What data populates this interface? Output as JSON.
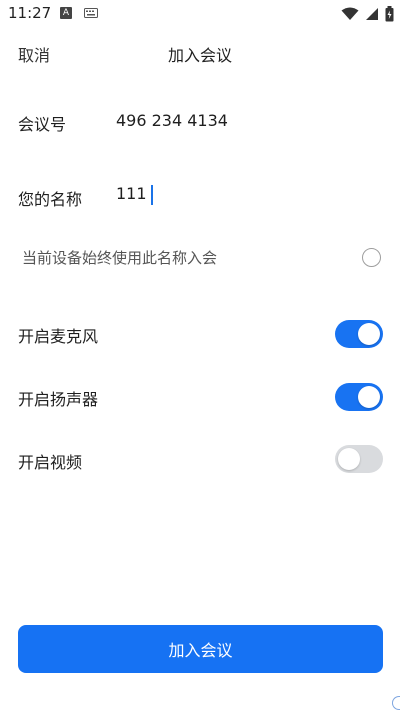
{
  "status_bar": {
    "time": "11:27",
    "notif_letter": "A"
  },
  "header": {
    "cancel_label": "取消",
    "title": "加入会议"
  },
  "meeting_id": {
    "label": "会议号",
    "value": "496 234 4134"
  },
  "display_name": {
    "label": "您的名称",
    "value": "111"
  },
  "remember_name": {
    "label": "当前设备始终使用此名称入会",
    "checked": false
  },
  "toggles": [
    {
      "label": "开启麦克风",
      "on": true
    },
    {
      "label": "开启扬声器",
      "on": true
    },
    {
      "label": "开启视频",
      "on": false
    }
  ],
  "join_button": {
    "label": "加入会议"
  },
  "colors": {
    "accent": "#1672f3",
    "switch_off": "#d9dbde"
  },
  "icons": [
    "wifi-icon",
    "cellular-signal-icon",
    "battery-icon",
    "keyboard-icon"
  ]
}
